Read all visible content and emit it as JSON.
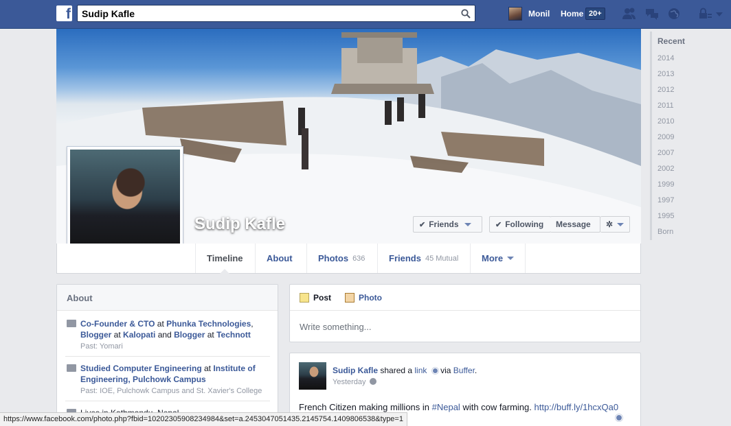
{
  "topbar": {
    "search_value": "Sudip Kafle",
    "user_name": "Monil",
    "home_label": "Home",
    "home_badge": "20+",
    "brand_color": "#3b5998"
  },
  "profile": {
    "name": "Sudip Kafle",
    "buttons": {
      "friends": "Friends",
      "following": "Following",
      "message": "Message"
    }
  },
  "tabs": [
    {
      "label": "Timeline"
    },
    {
      "label": "About"
    },
    {
      "label": "Photos",
      "count": "636"
    },
    {
      "label": "Friends",
      "count": "45 Mutual"
    },
    {
      "label": "More"
    }
  ],
  "years": [
    "Recent",
    "2014",
    "2013",
    "2012",
    "2011",
    "2010",
    "2009",
    "2007",
    "2002",
    "1999",
    "1997",
    "1995",
    "Born"
  ],
  "about": {
    "title": "About",
    "work": {
      "role1": "Co-Founder & CTO",
      "at1": " at ",
      "org1": "Phunka Technologies",
      "sep1": ", ",
      "role2": "Blogger",
      "at2": " at ",
      "org2": "Kalopati",
      "and": " and ",
      "role3": "Blogger",
      "at3": " at ",
      "org3": "Technott",
      "past": "Past: Yomari"
    },
    "education": {
      "studied": "Studied Computer Engineering",
      "at": " at ",
      "school": "Institute of Engineering, Pulchowk Campus",
      "past": "Past: IOE, Pulchowk Campus and St. Xavier's College"
    },
    "lives": "Lives in Kathmandu, Nepal"
  },
  "composer": {
    "post_tab": "Post",
    "photo_tab": "Photo",
    "placeholder": "Write something..."
  },
  "post": {
    "author": "Sudip Kafle",
    "shared": " shared a ",
    "link": "link",
    "via": " via ",
    "source": "Buffer",
    "period": ".",
    "time": "Yesterday",
    "text_before": "French Citizen making millions in ",
    "hashtag": "#Nepal",
    "text_mid": " with cow farming. ",
    "url": "http://buff.ly/1hcxQa0"
  },
  "status_url": "https://www.facebook.com/photo.php?fbid=10202305908234984&set=a.2453047051435.2145754.1409806538&type=1"
}
